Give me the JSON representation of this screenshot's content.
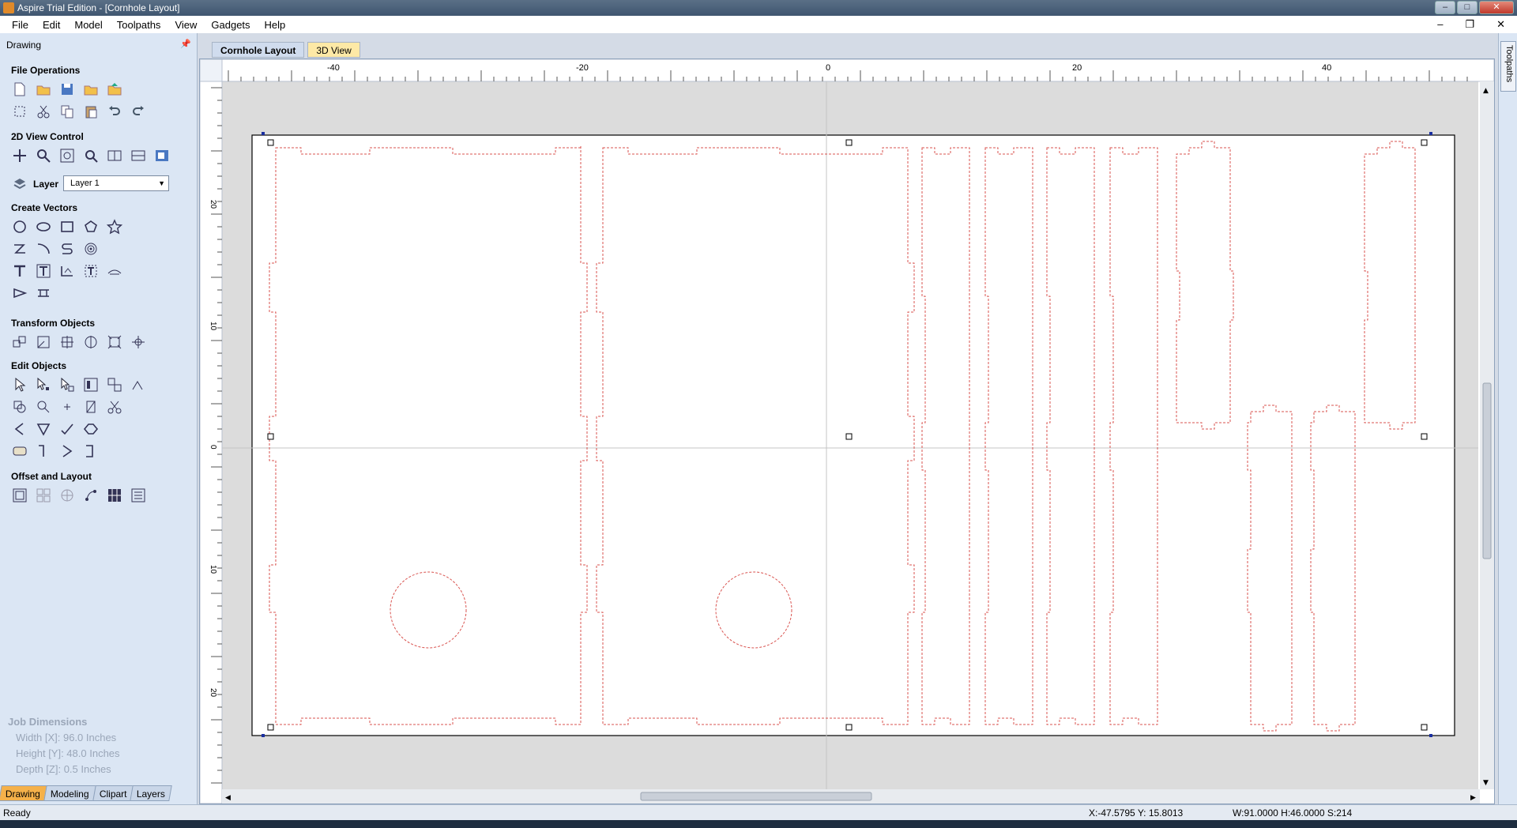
{
  "window": {
    "title": "Aspire Trial Edition - [Cornhole Layout]"
  },
  "menu": [
    "File",
    "Edit",
    "Model",
    "Toolpaths",
    "View",
    "Gadgets",
    "Help"
  ],
  "panel": {
    "title": "Drawing",
    "sections": {
      "file_ops": "File Operations",
      "view_control": "2D View Control",
      "create_vectors": "Create Vectors",
      "transform": "Transform Objects",
      "edit": "Edit Objects",
      "offset": "Offset and Layout"
    },
    "layer_label": "Layer",
    "layer_value": "Layer 1",
    "tabs": [
      "Drawing",
      "Modeling",
      "Clipart",
      "Layers"
    ]
  },
  "job_dimensions": {
    "title": "Job Dimensions",
    "width": "Width  [X]: 96.0 Inches",
    "height": "Height [Y]: 48.0 Inches",
    "depth": "Depth  [Z]: 0.5 Inches"
  },
  "doc_tabs": [
    "Cornhole Layout",
    "3D View"
  ],
  "side_tab": "Toolpaths",
  "ruler": {
    "h_labels": [
      "-40",
      "-20",
      "0",
      "20",
      "40"
    ],
    "v_labels": [
      "20",
      "10",
      "0",
      "10",
      "20"
    ]
  },
  "status": {
    "ready": "Ready",
    "coords": "X:-47.5795 Y: 15.8013",
    "dims": "W:91.0000   H:46.0000   S:214"
  },
  "colors": {
    "cut_line": "#d9534f",
    "panel_bg": "#dbe6f4",
    "active_tab": "#f5b14a"
  }
}
